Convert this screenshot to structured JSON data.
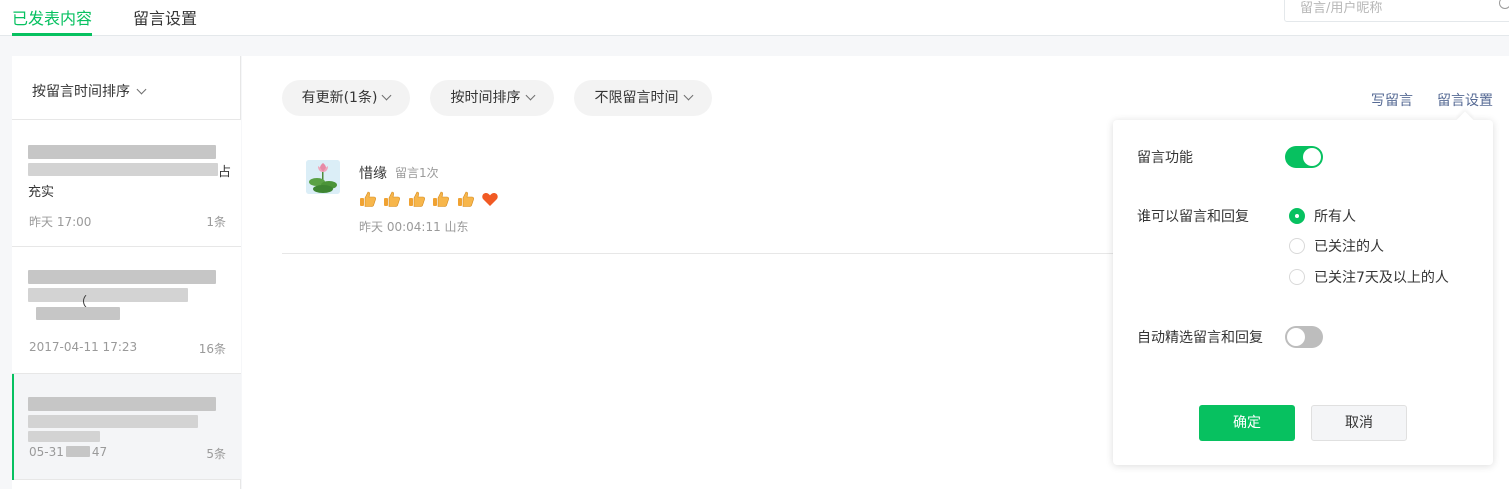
{
  "tabs": [
    {
      "label": "已发表内容",
      "active": true
    },
    {
      "label": "留言设置",
      "active": false
    }
  ],
  "search": {
    "placeholder": "留言/用户昵称"
  },
  "sidebar": {
    "sort_label": "按留言时间排序",
    "articles": [
      {
        "title_tail_1": "占",
        "title_line2": "充实",
        "date": "昨天 17:00",
        "count": "1条"
      },
      {
        "title_line2_visible": "（",
        "date": "2017-04-11 17:23",
        "count": "16条"
      },
      {
        "date": "05-31",
        "date_tail": "47",
        "count": "5条",
        "active": true
      }
    ]
  },
  "filters": {
    "updates": "有更新(1条)",
    "sort": "按时间排序",
    "time": "不限留言时间"
  },
  "actions": {
    "write": "写留言",
    "settings": "留言设置"
  },
  "comment": {
    "name": "惜缘",
    "count": "留言1次",
    "emojis": [
      "thumbs-up",
      "thumbs-up",
      "thumbs-up",
      "thumbs-up",
      "thumbs-up",
      "heart"
    ],
    "meta": "昨天 00:04:11 山东"
  },
  "settings_popover": {
    "comment_feature_label": "留言功能",
    "comment_feature_on": true,
    "who_label": "谁可以留言和回复",
    "who_options": [
      {
        "label": "所有人",
        "selected": true
      },
      {
        "label": "已关注的人",
        "selected": false
      },
      {
        "label": "已关注7天及以上的人",
        "selected": false
      }
    ],
    "auto_select_label": "自动精选留言和回复",
    "auto_select_on": false,
    "confirm_label": "确定",
    "cancel_label": "取消"
  },
  "colors": {
    "accent": "#07c160",
    "link": "#576b95",
    "muted": "#9a9a9a"
  }
}
